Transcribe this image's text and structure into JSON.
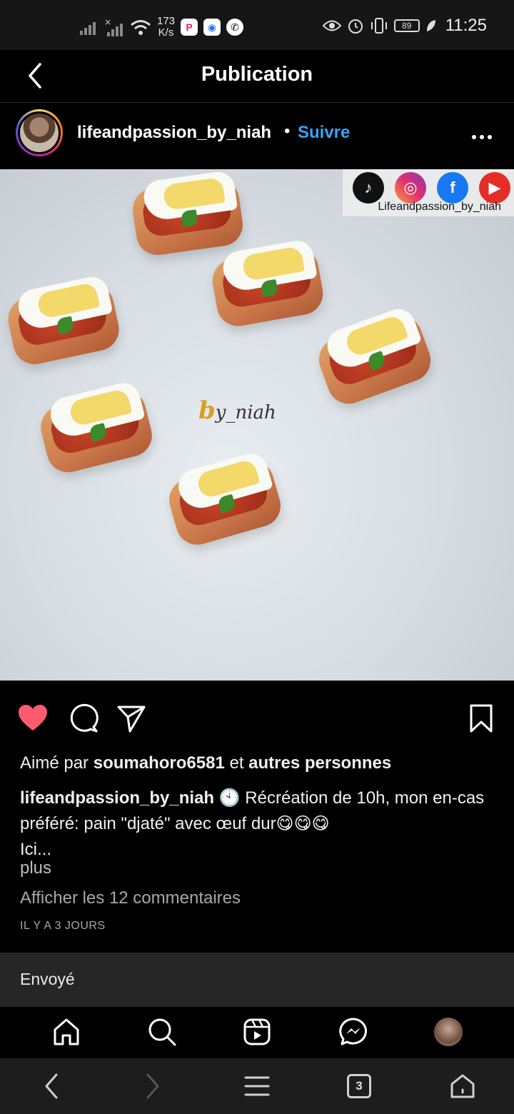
{
  "status_bar": {
    "net_speed_value": "173",
    "net_speed_unit": "K/s",
    "battery": "89",
    "time": "11:25",
    "icons": [
      "signal-icon",
      "signal-off-icon",
      "wifi-icon",
      "app-p-icon",
      "app-q-icon",
      "whatsapp-icon",
      "eye-icon",
      "alarm-icon",
      "vibrate-icon",
      "battery-icon",
      "leaf-icon"
    ]
  },
  "header": {
    "title": "Publication"
  },
  "post": {
    "username": "lifeandpassion_by_niah",
    "separator": "•",
    "follow_label": "Suivre",
    "more_label": "plus",
    "image": {
      "watermark": "Lifeandpassion_by_niah",
      "signature_b": "b",
      "signature_rest": "y_niah"
    },
    "likes_prefix": "Aimé par",
    "likes_user": "soumahoro6581",
    "likes_joiner": "et",
    "likes_suffix": "autres personnes",
    "caption_user": "lifeandpassion_by_niah",
    "caption_text": "🕙 Récréation de 10h, mon en-cas préféré: pain \"djaté\" avec œuf dur😋😋😋",
    "caption_line2": "Ici...",
    "comments_label": "Afficher les 12 commentaires",
    "timestamp": "IL Y A 3 JOURS",
    "sent_label": "Envoyé"
  },
  "browser": {
    "tab_count": "3"
  },
  "colors": {
    "follow": "#3aa3f5",
    "like": "#ff5b6e",
    "background": "#000000"
  }
}
